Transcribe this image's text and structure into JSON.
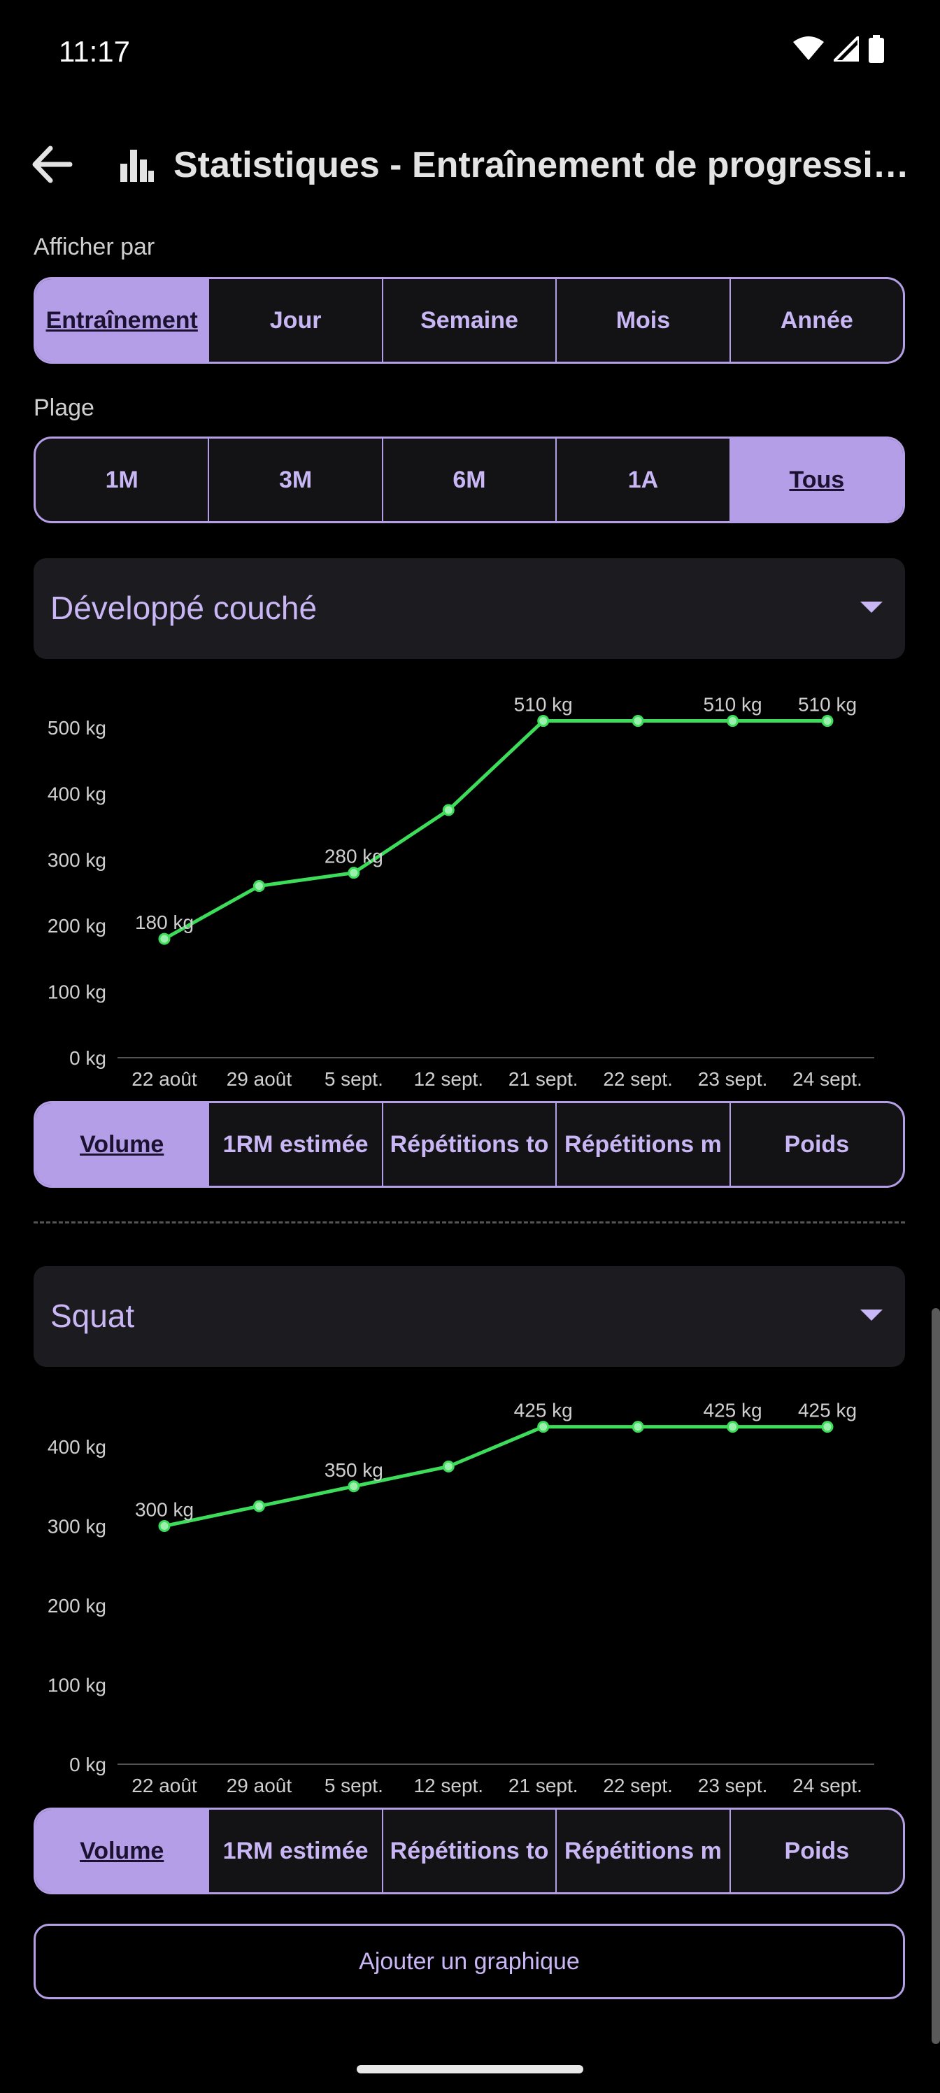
{
  "status": {
    "time": "11:17"
  },
  "appbar": {
    "title": "Statistiques - Entraînement de progressio…"
  },
  "view_by": {
    "label": "Afficher par",
    "options": [
      "Entraînement",
      "Jour",
      "Semaine",
      "Mois",
      "Année"
    ],
    "selected": 0
  },
  "range": {
    "label": "Plage",
    "options": [
      "1M",
      "3M",
      "6M",
      "1A",
      "Tous"
    ],
    "selected": 4
  },
  "metric_options": [
    "Volume",
    "1RM estimée",
    "Répétitions to",
    "Répétitions m",
    "Poids"
  ],
  "charts": [
    {
      "exercise": "Développé couché",
      "metric_selected": 0
    },
    {
      "exercise": "Squat",
      "metric_selected": 0
    }
  ],
  "add_chart_label": "Ajouter un graphique",
  "colors": {
    "accent": "#b59ee8",
    "line": "#3ddc5a",
    "background": "#000000"
  },
  "chart_data": [
    {
      "type": "line",
      "title": "Développé couché",
      "categories": [
        "22 août",
        "29 août",
        "5 sept.",
        "12 sept.",
        "21 sept.",
        "22 sept.",
        "23 sept.",
        "24 sept."
      ],
      "values": [
        180,
        260,
        280,
        375,
        510,
        510,
        510,
        510
      ],
      "data_labels": {
        "0": "180 kg",
        "2": "280 kg",
        "4": "510 kg",
        "6": "510 kg",
        "7": "510 kg"
      },
      "yticks": [
        "0 kg",
        "100 kg",
        "200 kg",
        "300 kg",
        "400 kg",
        "500 kg"
      ],
      "ylim": [
        0,
        500
      ],
      "unit": "kg"
    },
    {
      "type": "line",
      "title": "Squat",
      "categories": [
        "22 août",
        "29 août",
        "5 sept.",
        "12 sept.",
        "21 sept.",
        "22 sept.",
        "23 sept.",
        "24 sept."
      ],
      "values": [
        300,
        325,
        350,
        375,
        425,
        425,
        425,
        425
      ],
      "data_labels": {
        "0": "300 kg",
        "2": "350 kg",
        "4": "425 kg",
        "6": "425 kg",
        "7": "425 kg"
      },
      "yticks": [
        "0 kg",
        "100 kg",
        "200 kg",
        "300 kg",
        "400 kg"
      ],
      "ylim": [
        0,
        400
      ],
      "unit": "kg"
    }
  ]
}
